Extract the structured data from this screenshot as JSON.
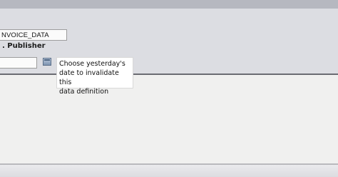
{
  "form": {
    "data_definition_name": "NVOICE_DATA",
    "publisher_label": ". Publisher",
    "expiry_date_value": ""
  },
  "tooltip": {
    "text": "Choose yesterday's\ndate to invalidate this\ndata definition"
  },
  "icons": {
    "calendar": "calendar-icon"
  }
}
